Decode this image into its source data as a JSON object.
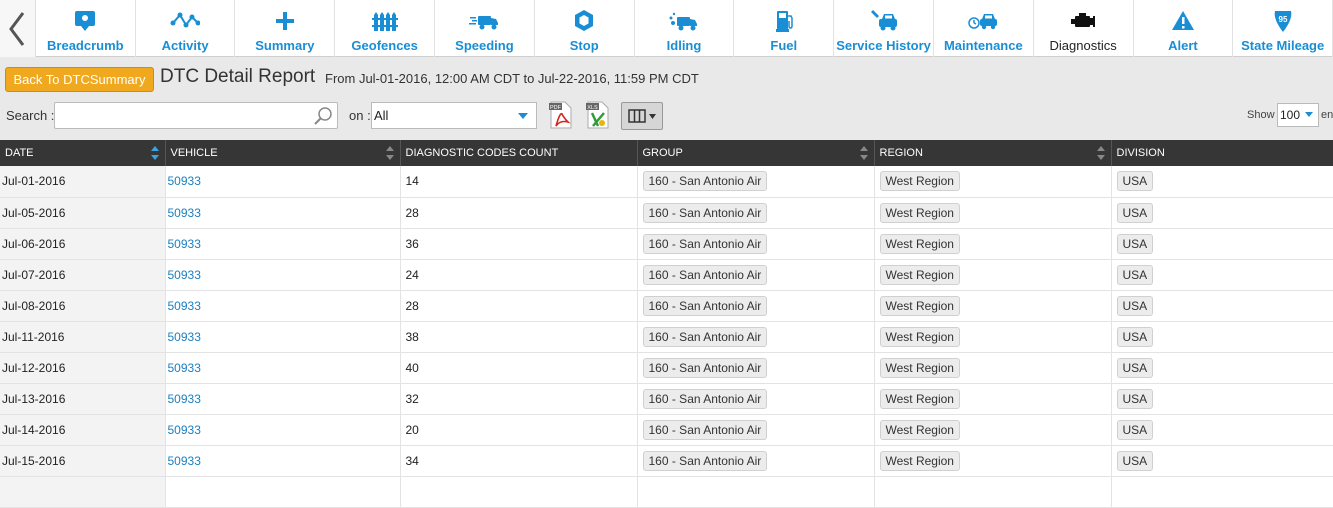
{
  "nav": {
    "items": [
      {
        "label": "Breadcrumb",
        "icon": "breadcrumb-icon",
        "active": false
      },
      {
        "label": "Activity",
        "icon": "activity-icon",
        "active": false
      },
      {
        "label": "Summary",
        "icon": "plus-icon",
        "active": false
      },
      {
        "label": "Geofences",
        "icon": "fence-icon",
        "active": false
      },
      {
        "label": "Speeding",
        "icon": "speeding-truck-icon",
        "active": false
      },
      {
        "label": "Stop",
        "icon": "stop-hexagon-icon",
        "active": false
      },
      {
        "label": "Idling",
        "icon": "idling-truck-icon",
        "active": false
      },
      {
        "label": "Fuel",
        "icon": "fuel-pump-icon",
        "active": false
      },
      {
        "label": "Service History",
        "icon": "service-car-icon",
        "active": false
      },
      {
        "label": "Maintenance",
        "icon": "maintenance-car-icon",
        "active": false
      },
      {
        "label": "Diagnostics",
        "icon": "engine-icon",
        "active": true
      },
      {
        "label": "Alert",
        "icon": "alert-icon",
        "active": false
      },
      {
        "label": "State Mileage",
        "icon": "interstate-shield-icon",
        "active": false
      }
    ],
    "shield_number": "95",
    "accent_color": "#1a8ed4"
  },
  "header": {
    "back_button": "Back To DTCSummary",
    "title": "DTC Detail Report",
    "range": "From Jul-01-2016, 12:00 AM CDT to Jul-22-2016, 11:59 PM CDT"
  },
  "toolbar": {
    "search_label": "Search :",
    "search_value": "",
    "on_label": "on :",
    "on_value": "All",
    "pdf_badge": "PDF",
    "xls_badge": "XLS",
    "show_label": "Show",
    "show_value": "100",
    "entries_label": "entries"
  },
  "table": {
    "columns": [
      "DATE",
      "VEHICLE",
      "DIAGNOSTIC CODES COUNT",
      "GROUP",
      "REGION",
      "DIVISION"
    ],
    "rows": [
      {
        "date": "Jul-01-2016",
        "vehicle": "50933",
        "count": "14",
        "group": "160 - San Antonio Air",
        "region": "West Region",
        "division": "USA"
      },
      {
        "date": "Jul-05-2016",
        "vehicle": "50933",
        "count": "28",
        "group": "160 - San Antonio Air",
        "region": "West Region",
        "division": "USA"
      },
      {
        "date": "Jul-06-2016",
        "vehicle": "50933",
        "count": "36",
        "group": "160 - San Antonio Air",
        "region": "West Region",
        "division": "USA"
      },
      {
        "date": "Jul-07-2016",
        "vehicle": "50933",
        "count": "24",
        "group": "160 - San Antonio Air",
        "region": "West Region",
        "division": "USA"
      },
      {
        "date": "Jul-08-2016",
        "vehicle": "50933",
        "count": "28",
        "group": "160 - San Antonio Air",
        "region": "West Region",
        "division": "USA"
      },
      {
        "date": "Jul-11-2016",
        "vehicle": "50933",
        "count": "38",
        "group": "160 - San Antonio Air",
        "region": "West Region",
        "division": "USA"
      },
      {
        "date": "Jul-12-2016",
        "vehicle": "50933",
        "count": "40",
        "group": "160 - San Antonio Air",
        "region": "West Region",
        "division": "USA"
      },
      {
        "date": "Jul-13-2016",
        "vehicle": "50933",
        "count": "32",
        "group": "160 - San Antonio Air",
        "region": "West Region",
        "division": "USA"
      },
      {
        "date": "Jul-14-2016",
        "vehicle": "50933",
        "count": "20",
        "group": "160 - San Antonio Air",
        "region": "West Region",
        "division": "USA"
      },
      {
        "date": "Jul-15-2016",
        "vehicle": "50933",
        "count": "34",
        "group": "160 - San Antonio Air",
        "region": "West Region",
        "division": "USA"
      }
    ]
  }
}
